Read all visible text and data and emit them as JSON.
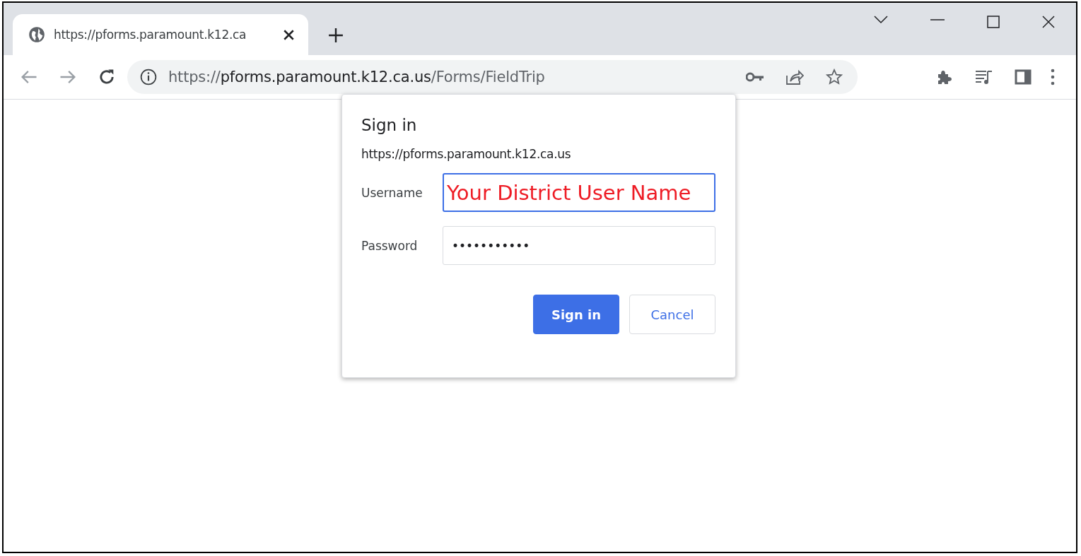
{
  "tabs": [
    {
      "title": "https://pforms.paramount.k12.ca",
      "selected": true
    }
  ],
  "address_bar": {
    "scheme": "https://",
    "host": "pforms.paramount.k12.ca.us",
    "path": "/Forms/FieldTrip"
  },
  "dialog": {
    "title": "Sign in",
    "origin": "https://pforms.paramount.k12.ca.us",
    "fields": [
      {
        "label": "Username",
        "value": "Your District User Name",
        "focused": true,
        "color": "#ee1c25"
      },
      {
        "label": "Password",
        "value": "•••••••••••",
        "focused": false,
        "color": "#202124"
      }
    ],
    "buttons": [
      {
        "label": "Sign in",
        "kind": "primary"
      },
      {
        "label": "Cancel",
        "kind": "secondary"
      }
    ]
  }
}
